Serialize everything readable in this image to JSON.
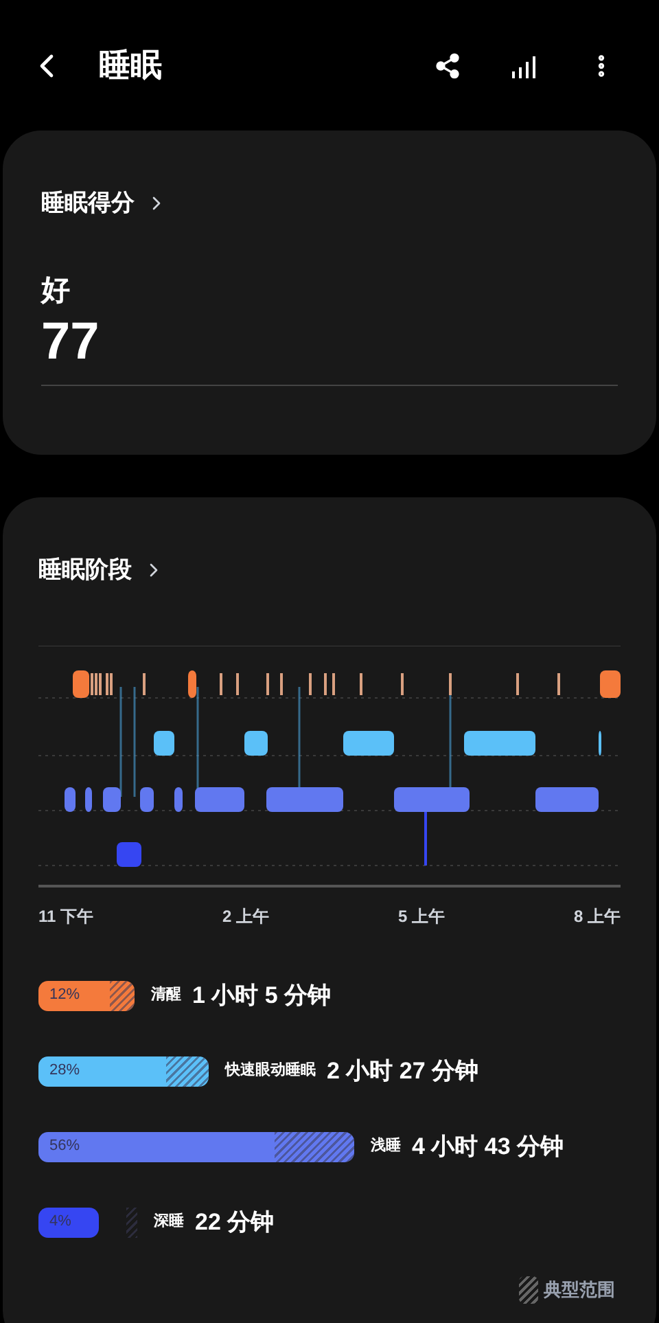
{
  "header": {
    "title": "睡眠"
  },
  "score_card": {
    "title": "睡眠得分",
    "rating": "好",
    "score": "77"
  },
  "stages_card": {
    "title": "睡眠阶段",
    "x_labels": [
      "11 下午",
      "2 上午",
      "5 上午",
      "8 上午"
    ],
    "stages": [
      {
        "percent": "12%",
        "label": "清醒",
        "duration": "1 小时 5 分钟",
        "color": "#f47a3c"
      },
      {
        "percent": "28%",
        "label": "快速眼动睡眠",
        "duration": "2 小时 27 分钟",
        "color": "#5bc0f8"
      },
      {
        "percent": "56%",
        "label": "浅睡",
        "duration": "4 小时 43 分钟",
        "color": "#6178f0"
      },
      {
        "percent": "4%",
        "label": "深睡",
        "duration": "22 分钟",
        "color": "#3646f2"
      }
    ],
    "legend": "典型范围"
  }
}
